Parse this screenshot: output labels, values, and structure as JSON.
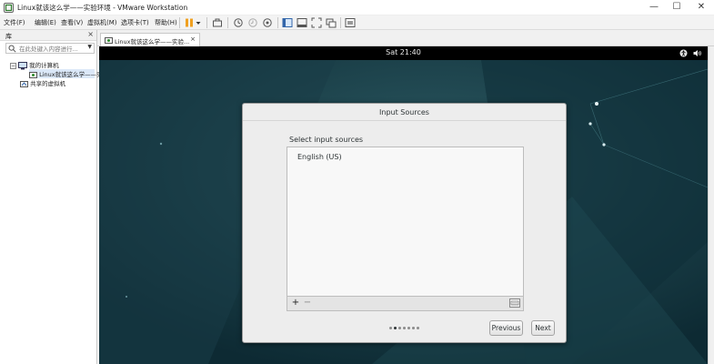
{
  "window": {
    "title": "Linux就该这么学——实验环境 - VMware Workstation",
    "icon": "vmware-app-icon",
    "controls": [
      "minimize",
      "maximize",
      "close"
    ]
  },
  "menu": {
    "items": [
      "文件(F)",
      "编辑(E)",
      "查看(V)",
      "虚拟机(M)",
      "选项卡(T)",
      "帮助(H)"
    ]
  },
  "toolbar": {
    "icons": [
      "pause-icon",
      "dropdown-icon",
      "send-ctrl-alt-del-icon",
      "snapshot-icon",
      "revert-snapshot-icon",
      "snapshot-manager-icon",
      "library-view-icon",
      "thumbnail-view-icon",
      "fullscreen-icon",
      "unity-icon",
      "console-view-icon"
    ]
  },
  "library": {
    "title": "库",
    "close_label": "×",
    "search_placeholder": "在此处键入内容进行...",
    "tree": {
      "my_computer": "我的计算机",
      "vm_item": "Linux就该这么学——实",
      "shared_vms": "共享的虚拟机"
    }
  },
  "tabs": {
    "active_label": "Linux就该这么学——实验...",
    "close_label": "×"
  },
  "guest": {
    "clock": "Sat 21:40",
    "status_icons": [
      "accessibility-icon",
      "volume-icon"
    ],
    "colors": {
      "wallpaper": "#163640",
      "topbar": "#000000",
      "dialog_bg": "#ededed"
    }
  },
  "dialog": {
    "title": "Input Sources",
    "section_label": "Select input sources",
    "sources": [
      "English (US)"
    ],
    "add_label": "+",
    "remove_label": "−",
    "page_count": 7,
    "current_page": 2,
    "previous_label": "Previous",
    "next_label": "Next"
  }
}
